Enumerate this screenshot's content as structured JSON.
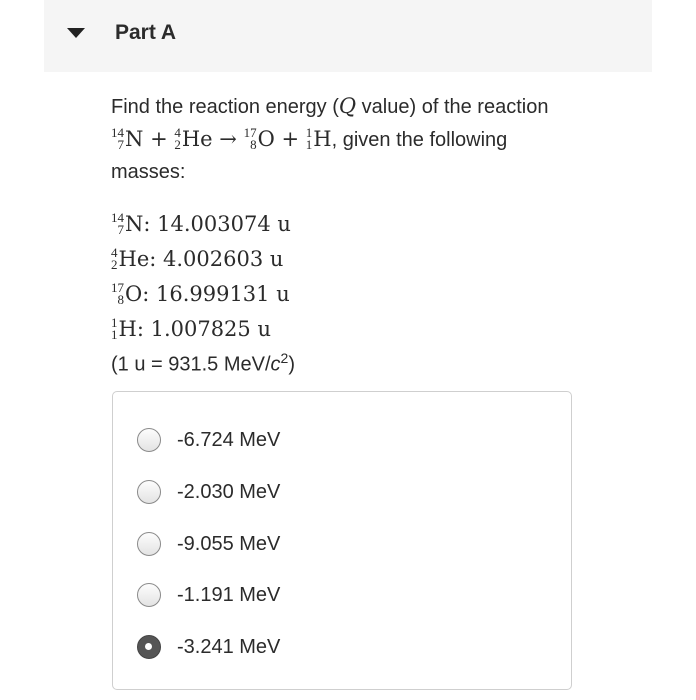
{
  "part": {
    "title": "Part A"
  },
  "question": {
    "prefix": "Find the reaction energy (",
    "q_symbol": "Q",
    "suffix": " value) of the reaction",
    "reaction": {
      "n": {
        "mass": "14",
        "atomic": "7",
        "symbol": "N"
      },
      "plus1": "+",
      "he": {
        "mass": "4",
        "atomic": "2",
        "symbol": "He"
      },
      "arrow": "→",
      "o": {
        "mass": "17",
        "atomic": "8",
        "symbol": "O"
      },
      "plus2": "+",
      "h": {
        "mass": "1",
        "atomic": "1",
        "symbol": "H"
      }
    },
    "tail": ", given the following",
    "tail2": "masses:"
  },
  "masses": [
    {
      "mass": "14",
      "atomic": "7",
      "symbol": "N",
      "value": ":  14.003074 u"
    },
    {
      "mass": "4",
      "atomic": "2",
      "symbol": "He",
      "value": ":  4.002603 u"
    },
    {
      "mass": "17",
      "atomic": "8",
      "symbol": "O",
      "value": ":  16.999131 u"
    },
    {
      "mass": "1",
      "atomic": "1",
      "symbol": "H",
      "value": ":  1.007825 u"
    }
  ],
  "conversion": {
    "text": "(1 u = 931.5 MeV/",
    "c": "c",
    "exp": "2",
    "close": ")"
  },
  "choices": [
    {
      "label": "-6.724 MeV",
      "checked": false
    },
    {
      "label": "-2.030 MeV",
      "checked": false
    },
    {
      "label": "-9.055 MeV",
      "checked": false
    },
    {
      "label": "-1.191 MeV",
      "checked": false
    },
    {
      "label": "-3.241 MeV",
      "checked": true
    }
  ]
}
